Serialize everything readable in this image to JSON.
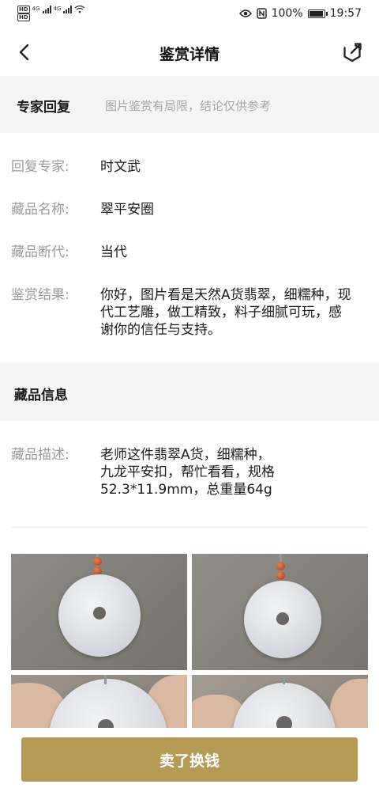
{
  "status_bar": {
    "hd1": "HD",
    "hd2": "HD",
    "net1": "4G",
    "net2": "4G",
    "battery_percent": "100%",
    "battery_level": 1.0,
    "time": "19:57",
    "icons": [
      "eye-icon",
      "nfc-icon",
      "wifi-icon",
      "battery-icon"
    ]
  },
  "nav": {
    "title": "鉴赏详情",
    "back_icon": "back-arrow-icon",
    "share_icon": "share-icon"
  },
  "expert_reply": {
    "title": "专家回复",
    "note": "图片鉴赏有局限，结论仅供参考",
    "fields": [
      {
        "label": "回复专家:",
        "value": "时文武"
      },
      {
        "label": "藏品名称:",
        "value": "翠平安圈"
      },
      {
        "label": "藏品断代:",
        "value": "当代"
      },
      {
        "label": "鉴赏结果:",
        "value": "你好，图片看是天然A货翡翠，细糯种，现代工艺雕，做工精致，料子细腻可玩，感谢你的信任与支持。"
      }
    ]
  },
  "collection_info": {
    "title": "藏品信息",
    "description_label": "藏品描述:",
    "description_value": "老师这件翡翠A货，细糯种，\n九龙平安扣，帮忙看看，规格\n52.3*11.9mm，总重量64g"
  },
  "photos": [
    {
      "name": "jade-photo-front"
    },
    {
      "name": "jade-photo-back"
    },
    {
      "name": "jade-photo-hand-1"
    },
    {
      "name": "jade-photo-hand-2"
    }
  ],
  "footer": {
    "sell_label": "卖了换钱"
  }
}
